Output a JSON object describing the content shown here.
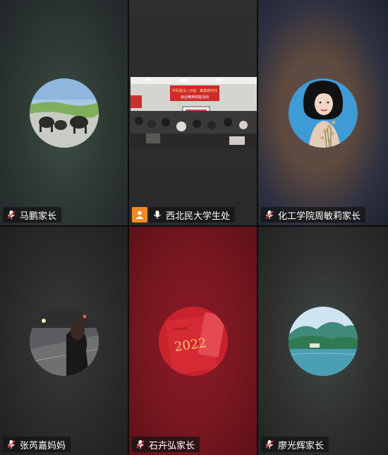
{
  "tiles": [
    {
      "name": "马鹏家长",
      "mic": "muted",
      "avatar": "yak-landscape"
    },
    {
      "name": "西北民大学生处",
      "mic": "on",
      "host": true,
      "video": "meeting-room-presentation",
      "banner": {
        "line1": "学风建设 | 对话 · 聚集新时代",
        "line2": "就业精神讲座活动"
      }
    },
    {
      "name": "化工学院周敏莉家长",
      "mic": "muted",
      "avatar": "woman-with-flowers"
    },
    {
      "name": "张芮嘉妈妈",
      "mic": "muted",
      "avatar": "person-night-street"
    },
    {
      "name": "石卉弘家长",
      "mic": "muted",
      "avatar": "red-2022-notebook",
      "avatar_text": "2022"
    },
    {
      "name": "廖光辉家长",
      "mic": "muted",
      "avatar": "mountain-lake"
    }
  ],
  "colors": {
    "host_badge": "#f08a24",
    "label_bg": "rgba(20,20,20,0.72)"
  }
}
